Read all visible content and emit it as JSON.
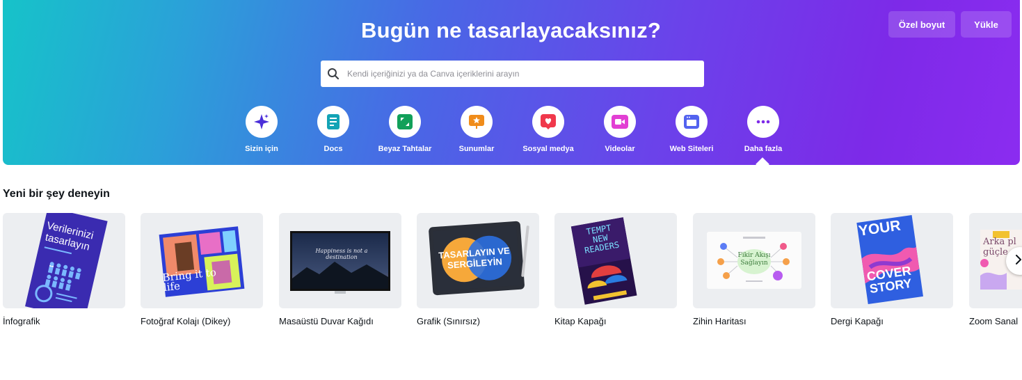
{
  "hero": {
    "title": "Bugün ne tasarlayacaksınız?",
    "custom_size_label": "Özel boyut",
    "upload_label": "Yükle",
    "search_placeholder": "Kendi içeriğinizi ya da Canva içeriklerini arayın",
    "search_icon": "search-icon",
    "gradient_colors": [
      "#16c3c9",
      "#4a66e6",
      "#7d2ae8"
    ]
  },
  "categories": [
    {
      "label": "Sizin için",
      "icon": "sparkle-icon",
      "color": "#4b2fd9"
    },
    {
      "label": "Docs",
      "icon": "docs-icon",
      "color": "#13a3b5"
    },
    {
      "label": "Beyaz Tahtalar",
      "icon": "whiteboard-icon",
      "color": "#12a05a"
    },
    {
      "label": "Sunumlar",
      "icon": "presentation-icon",
      "color": "#f08c1a"
    },
    {
      "label": "Sosyal medya",
      "icon": "heart-icon",
      "color": "#f0384b"
    },
    {
      "label": "Videolar",
      "icon": "video-icon",
      "color": "#e23fd3"
    },
    {
      "label": "Web Siteleri",
      "icon": "website-icon",
      "color": "#5363ef"
    },
    {
      "label": "Daha fazla",
      "icon": "more-icon",
      "color": "#7d2ae8"
    }
  ],
  "section": {
    "title": "Yeni bir şey deneyin"
  },
  "cards": [
    {
      "label": "İnfografik",
      "thumb_text": "Verilerinizi tasarlayın"
    },
    {
      "label": "Fotoğraf Kolajı (Dikey)",
      "thumb_text": "Bring it to life"
    },
    {
      "label": "Masaüstü Duvar Kağıdı",
      "thumb_text": "Happiness is not a destination"
    },
    {
      "label": "Grafik (Sınırsız)",
      "thumb_text": "TASARLAYIN VE SERGİLEYİN"
    },
    {
      "label": "Kitap Kapağı",
      "thumb_text": "TEMPT NEW READERS"
    },
    {
      "label": "Zihin Haritası",
      "thumb_text": "Fikir Akışı Sağlayın"
    },
    {
      "label": "Dergi Kapağı",
      "thumb_text_top": "YOUR",
      "thumb_text_bottom": "COVER STORY"
    },
    {
      "label": "Zoom Sanal",
      "thumb_text": "Arka pl güçle"
    }
  ],
  "next_icon": "chevron-right-icon"
}
